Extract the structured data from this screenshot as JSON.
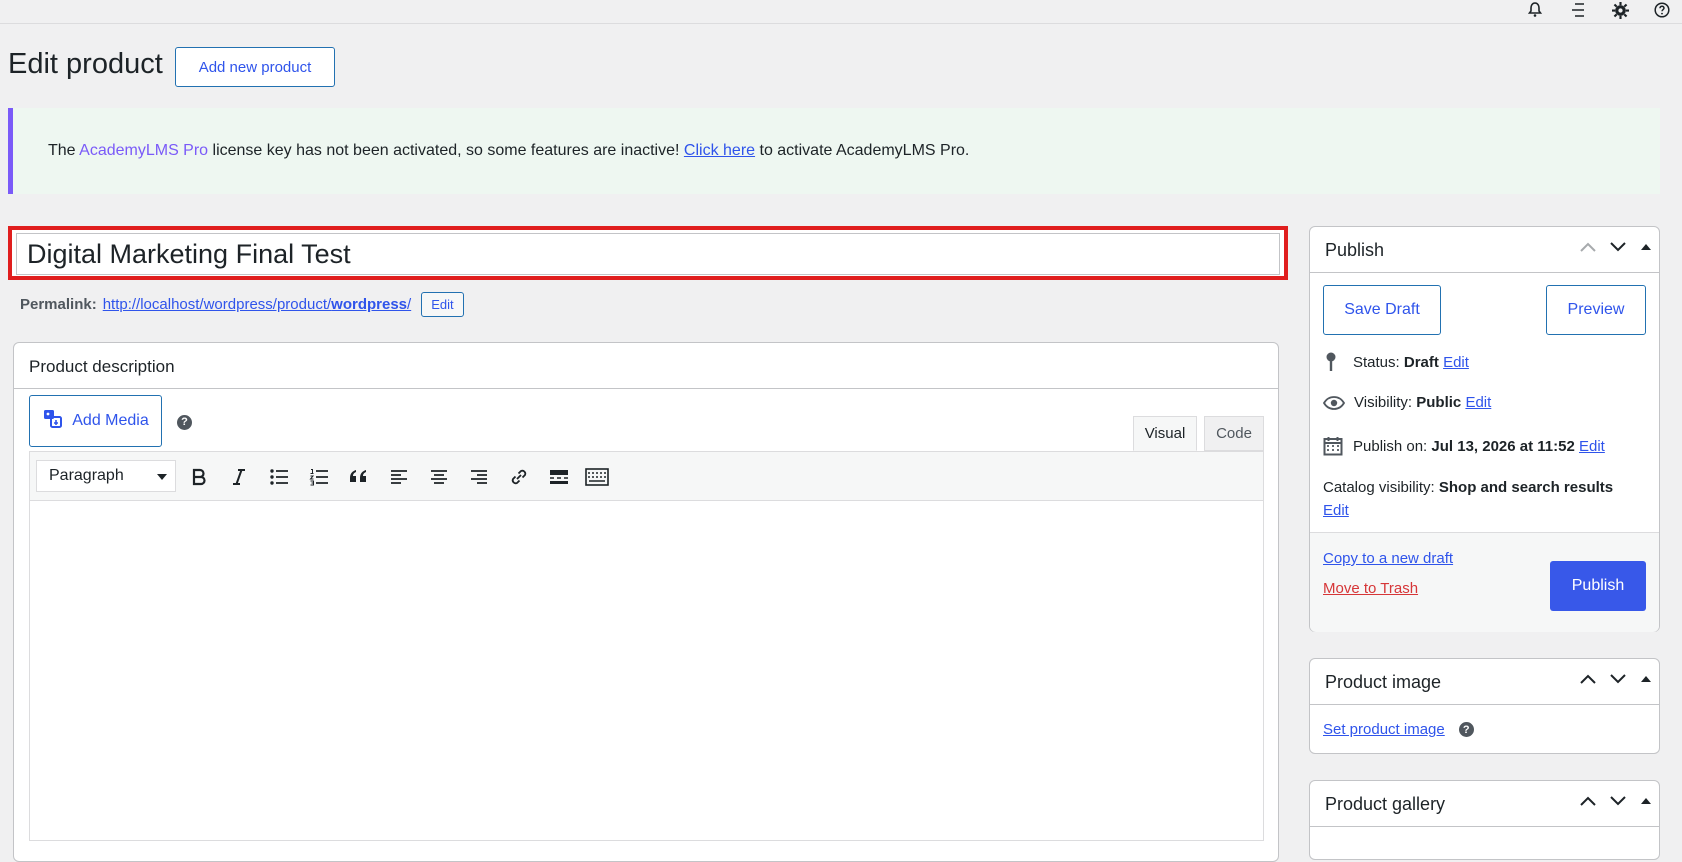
{
  "page": {
    "title": "Edit product",
    "add_new_label": "Add new product"
  },
  "notice": {
    "prefix": "The ",
    "brand": "AcademyLMS Pro",
    "middle": " license key has not been activated, so some features are inactive! ",
    "link": "Click here",
    "suffix": " to activate AcademyLMS Pro.",
    "brand_color": "#7a5af8"
  },
  "title_field": {
    "value": "Digital Marketing Final Test",
    "highlight_color": "#e01e1e"
  },
  "permalink": {
    "label": "Permalink:",
    "url_base": "http://localhost/wordpress/product/",
    "url_slug": "wordpress",
    "url_trail": "/",
    "edit_label": "Edit"
  },
  "description": {
    "title": "Product description",
    "add_media_label": "Add Media",
    "help_glyph": "?",
    "tab_visual": "Visual",
    "tab_code": "Code",
    "format_value": "Paragraph",
    "toolbar_icons": [
      "bold-icon",
      "italic-icon",
      "bullet-list-icon",
      "numbered-list-icon",
      "blockquote-icon",
      "align-left-icon",
      "align-center-icon",
      "align-right-icon",
      "link-icon",
      "read-more-icon",
      "toolbar-toggle-icon"
    ]
  },
  "publish": {
    "title": "Publish",
    "save_draft": "Save Draft",
    "preview": "Preview",
    "status_label": "Status:",
    "status_value": "Draft",
    "visibility_label": "Visibility:",
    "visibility_value": "Public",
    "publish_on_label": "Publish on:",
    "publish_on_value": "Jul 13, 2026 at 11:52",
    "catalog_label": "Catalog visibility:",
    "catalog_value": "Shop and search results",
    "edit": "Edit",
    "copy_draft": "Copy to a new draft",
    "trash": "Move to Trash",
    "publish_button": "Publish",
    "accent_color": "#3858e9"
  },
  "product_image": {
    "title": "Product image",
    "set_link": "Set product image",
    "help_glyph": "?"
  },
  "product_gallery": {
    "title": "Product gallery"
  },
  "topbar": {
    "icons": [
      "notification-icon",
      "menu-icon",
      "settings-icon",
      "help-icon"
    ]
  }
}
